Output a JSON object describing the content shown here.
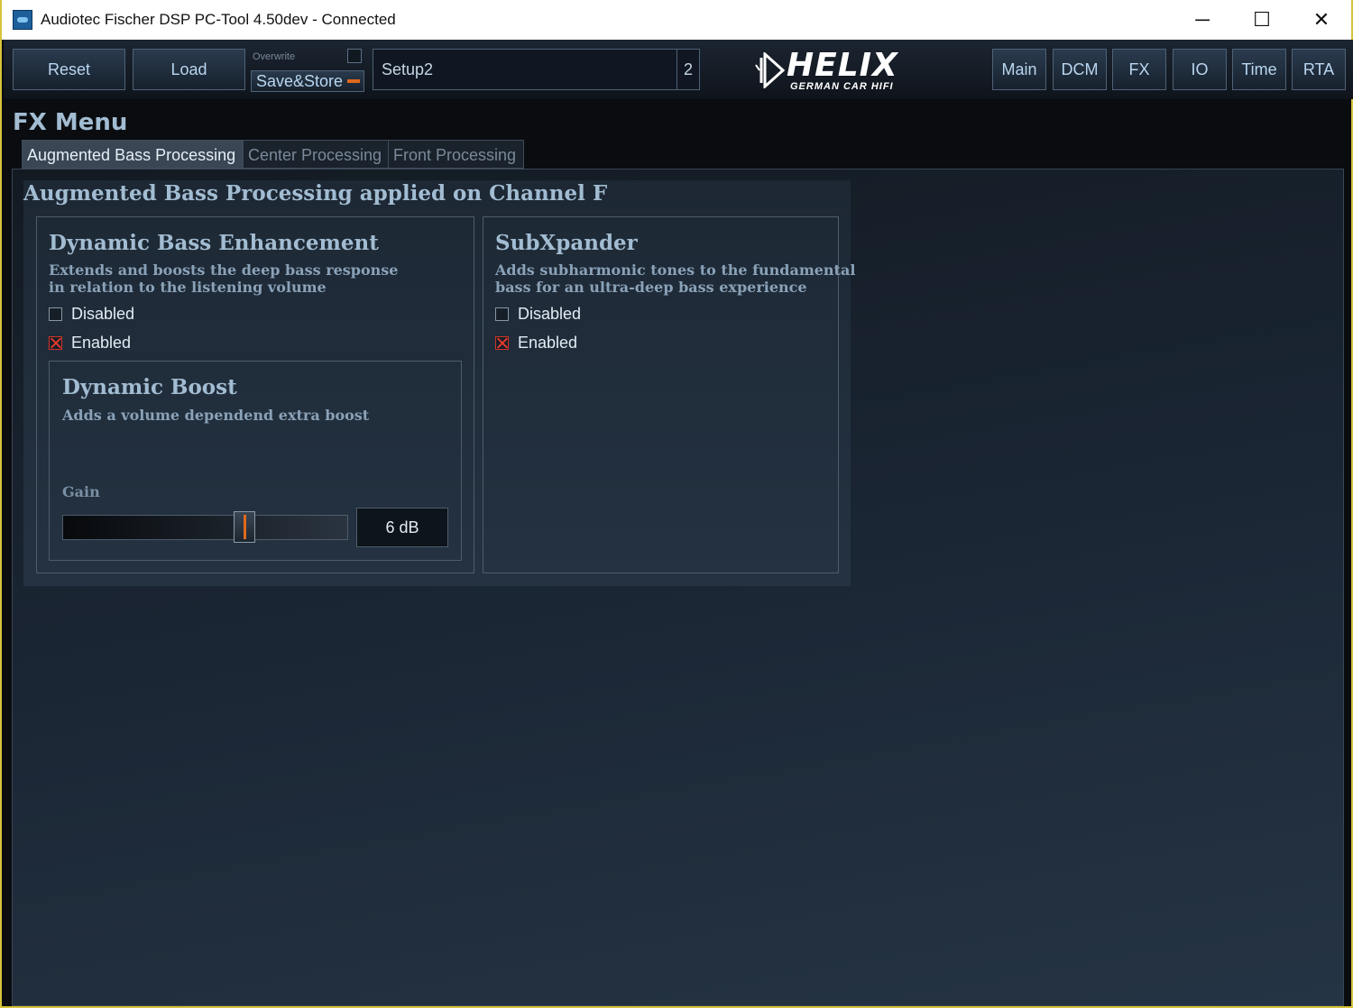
{
  "window": {
    "title": "Audiotec Fischer DSP PC-Tool 4.50dev - Connected",
    "controls": {
      "minimize": "─",
      "maximize": "☐",
      "close": "✕"
    }
  },
  "toolbar": {
    "reset_label": "Reset",
    "load_label": "Load",
    "overwrite_label": "Overwrite",
    "save_store_label": "Save&Store",
    "setup_name": "Setup2",
    "setup_number": "2",
    "logo_text": "HELIX",
    "logo_subtext": "GERMAN CAR HIFI",
    "nav": [
      "Main",
      "DCM",
      "FX",
      "IO",
      "Time",
      "RTA"
    ]
  },
  "page": {
    "title": "FX Menu",
    "tabs": [
      "Augmented Bass Processing",
      "Center Processing",
      "Front Processing"
    ],
    "active_tab": "Augmented Bass Processing",
    "section_title": "Augmented Bass Processing applied on Channel F"
  },
  "dbe": {
    "title": "Dynamic Bass Enhancement",
    "desc_line1": "Extends and boosts the deep bass response",
    "desc_line2": "in relation to the listening volume",
    "disabled_label": "Disabled",
    "enabled_label": "Enabled",
    "state": "Enabled"
  },
  "boost": {
    "title": "Dynamic Boost",
    "desc": "Adds a volume dependend extra boost",
    "gain_label": "Gain",
    "gain_value": "6 dB",
    "slider_fraction": 0.65
  },
  "subx": {
    "title": "SubXpander",
    "desc_line1": "Adds subharmonic tones to the fundamental",
    "desc_line2": "bass for an ultra-deep bass experience",
    "disabled_label": "Disabled",
    "enabled_label": "Enabled",
    "state": "Enabled"
  },
  "colors": {
    "accent_orange": "#e0691c",
    "check_red": "#e23a2c",
    "title_blue": "#a2bcd2",
    "window_border": "#d8c23a"
  }
}
